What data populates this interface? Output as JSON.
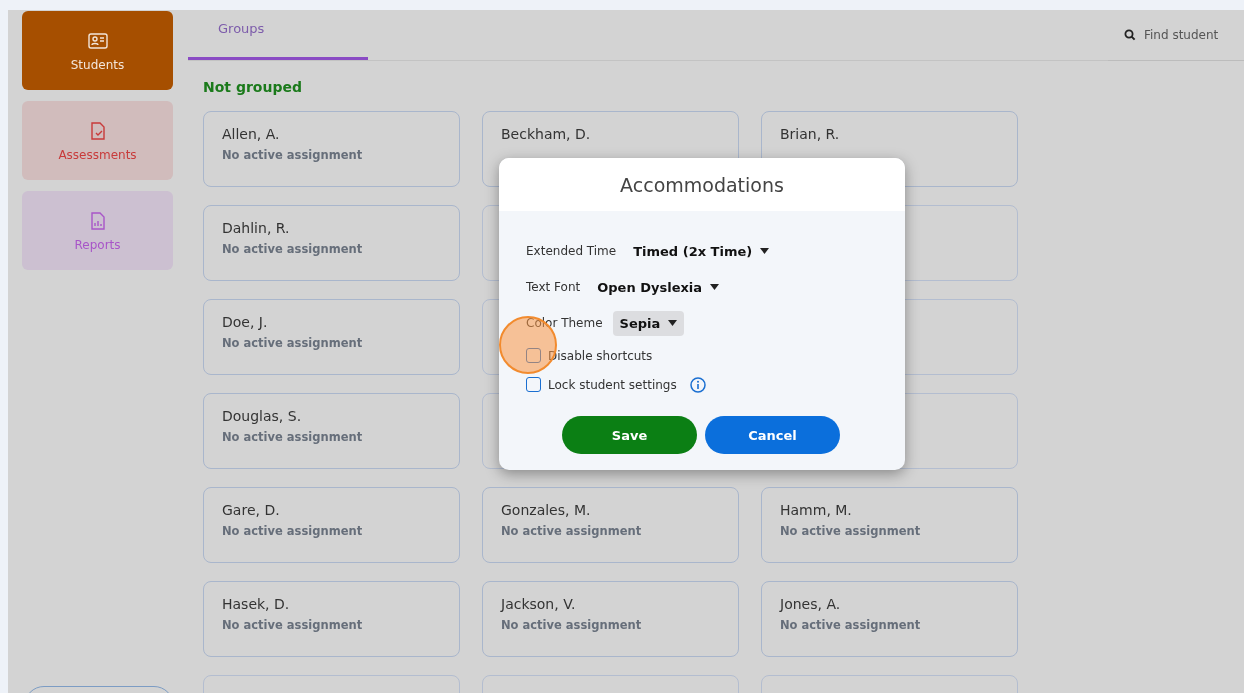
{
  "sidebar": {
    "items": [
      {
        "label": "Students",
        "selected": true,
        "color": "#a64f00"
      },
      {
        "label": "Assessments",
        "selected": false,
        "color": "#c83a3a"
      },
      {
        "label": "Reports",
        "selected": false,
        "color": "#a855c8"
      }
    ]
  },
  "tabs": [
    {
      "label": "Groups",
      "selected": true
    }
  ],
  "search": {
    "placeholder": "Find student"
  },
  "section_title": "Not grouped",
  "cards": [
    {
      "name": "Allen, A.",
      "status": "No active assignment"
    },
    {
      "name": "Beckham, D."
    },
    {
      "name": "Brian, R."
    },
    {
      "name": "Dahlin, R.",
      "status": "No active assignment"
    },
    {
      "covered": true
    },
    {
      "covered": true
    },
    {
      "name": "Doe, J.",
      "status": "No active assignment"
    },
    {
      "covered": true
    },
    {
      "covered": true
    },
    {
      "name": "Douglas, S.",
      "status": "No active assignment"
    },
    {
      "covered": true
    },
    {
      "covered": true
    },
    {
      "name": "Gare, D.",
      "status": "No active assignment"
    },
    {
      "name": "Gonzales, M.",
      "status": "No active assignment"
    },
    {
      "name": "Hamm, M.",
      "status": "No active assignment"
    },
    {
      "name": "Hasek, D.",
      "status": "No active assignment"
    },
    {
      "name": "Jackson, V.",
      "status": "No active assignment"
    },
    {
      "name": "Jones, A.",
      "status": "No active assignment"
    },
    {
      "covered": true
    },
    {
      "covered": true
    },
    {
      "covered": true
    }
  ],
  "dialog": {
    "title": "Accommodations",
    "settings": [
      {
        "kind": "dropdown",
        "label": "Extended Time",
        "value": "Timed (2x Time)",
        "highlighted": false
      },
      {
        "kind": "dropdown",
        "label": "Text Font",
        "value": "Open Dyslexia",
        "highlighted": false
      },
      {
        "kind": "dropdown",
        "label": "Color Theme",
        "value": "Sepia",
        "highlighted": true
      },
      {
        "kind": "checkbox",
        "label": "Disable shortcuts",
        "checked": false
      },
      {
        "kind": "checkbox",
        "label": "Lock student settings",
        "checked": false,
        "info": true
      }
    ],
    "buttons": [
      {
        "label": "Save",
        "kind": "primary"
      },
      {
        "label": "Cancel",
        "kind": "secondary"
      }
    ]
  }
}
